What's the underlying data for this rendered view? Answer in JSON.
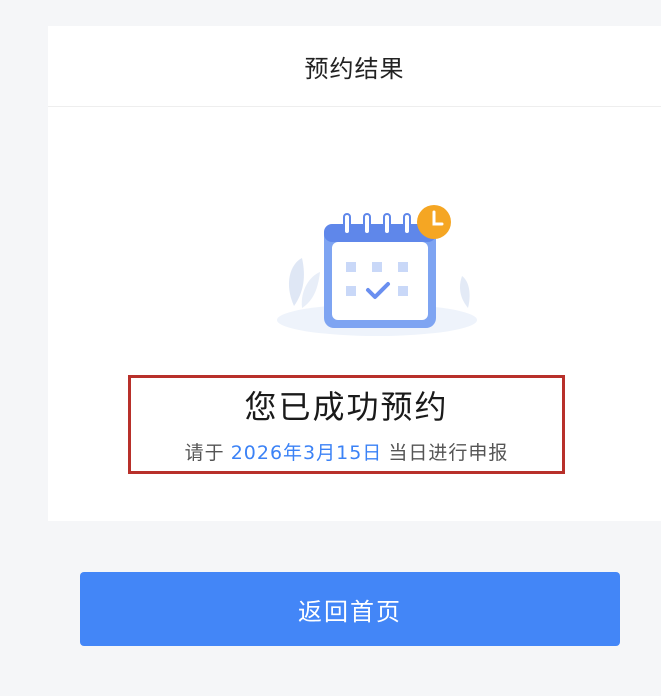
{
  "header": {
    "title": "预约结果"
  },
  "illustration": {
    "icon": "calendar-check-with-clock-icon"
  },
  "result": {
    "title": "您已成功预约",
    "prefix": "请于",
    "date": "2026年3月15日",
    "suffix": "当日进行申报"
  },
  "actions": {
    "return_label": "返回首页"
  },
  "colors": {
    "accent": "#4386f7",
    "date_text": "#3b82f6",
    "highlight_border": "#b8302a",
    "clock_badge": "#f5a623"
  }
}
